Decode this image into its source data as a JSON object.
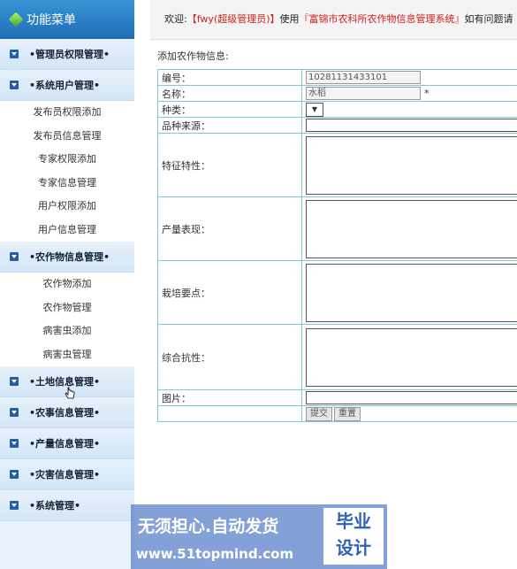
{
  "sidebar": {
    "title": "功能菜单",
    "groups": [
      {
        "label": "•管理员权限管理•",
        "items": []
      },
      {
        "label": "•系统用户管理•",
        "items": [
          "发布员权限添加",
          "发布员信息管理",
          "专家权限添加",
          "专家信息管理",
          "用户权限添加",
          "用户信息管理"
        ]
      },
      {
        "label": "•农作物信息管理•",
        "items": [
          "农作物添加",
          "农作物管理",
          "病害虫添加",
          "病害虫管理"
        ]
      },
      {
        "label": "•土地信息管理•",
        "items": []
      },
      {
        "label": "•农事信息管理•",
        "items": []
      },
      {
        "label": "•产量信息管理•",
        "items": []
      },
      {
        "label": "•灾害信息管理•",
        "items": []
      },
      {
        "label": "•系统管理•",
        "items": []
      }
    ]
  },
  "topbar": {
    "welcome": "欢迎:",
    "user": "【fwy(超级管理员)】",
    "use": "使用",
    "system": "『富锦市农科所农作物信息管理系统』",
    "tail": "如有问题请"
  },
  "form": {
    "heading": "添加农作物信息:",
    "code_label": "编号：",
    "code_value": "10281131433101",
    "name_label": "名称：",
    "name_value": "水稻",
    "required_mark": "*",
    "type_label": "种类：",
    "source_label": "品种来源：",
    "feature_label": "特征特性：",
    "yield_label": "产量表现：",
    "cultivation_label": "栽培要点：",
    "resistance_label": "综合抗性：",
    "image_label": "图片：",
    "submit_label": "提交",
    "reset_label": "重置"
  },
  "watermark": {
    "line1": "无须担心.自动发货",
    "line2": "www.51topmind.com",
    "badge_top": "毕业",
    "badge_bottom": "设计"
  }
}
